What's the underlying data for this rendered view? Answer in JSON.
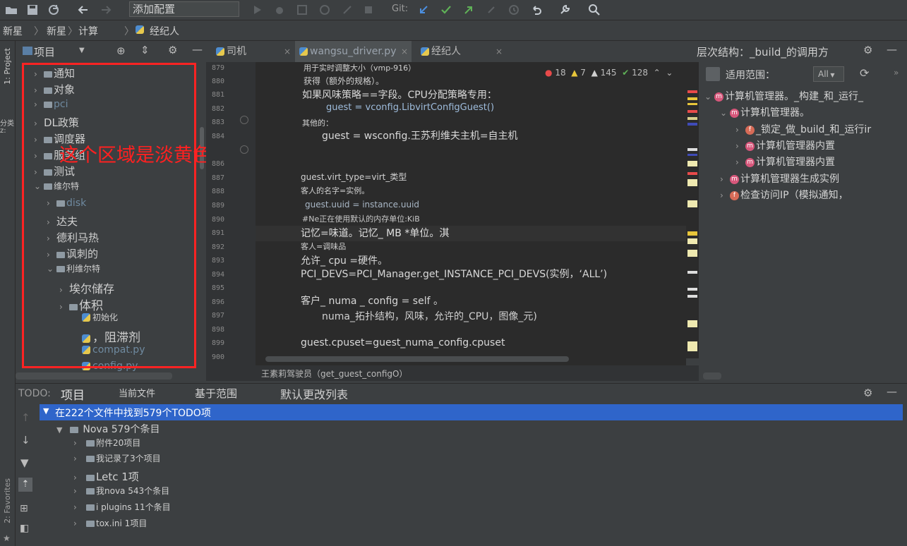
{
  "toolbar": {
    "config_combo": "添加配置",
    "git_label": "Git:"
  },
  "breadcrumb": [
    "新星",
    "新星",
    "计算",
    "经纪人"
  ],
  "left_stripe": {
    "project_tab": "1: Project",
    "structure_hint": "分类",
    "structure_hint2": "z:",
    "favorites_tab": "2: Favorites"
  },
  "project_panel": {
    "title": "项目",
    "items": [
      {
        "label": "通知",
        "indent": 1,
        "kind": "folder-arrow"
      },
      {
        "label": "对象",
        "indent": 1,
        "kind": "folder-arrow"
      },
      {
        "label": "pci",
        "indent": 1,
        "kind": "folder-arrow-dim"
      },
      {
        "label": "DL政策",
        "indent": 1,
        "kind": "arrow"
      },
      {
        "label": "调度器",
        "indent": 1,
        "kind": "folder-arrow"
      },
      {
        "label": "服务组",
        "indent": 1,
        "kind": "folder-arrow"
      },
      {
        "label": "测试",
        "indent": 1,
        "kind": "folder-arrow"
      },
      {
        "label": "维尔特",
        "indent": 1,
        "kind": "folder-open"
      },
      {
        "label": "disk",
        "indent": 2,
        "kind": "folder-arrow-dim"
      },
      {
        "label": "达夫",
        "indent": 2,
        "kind": "arrow"
      },
      {
        "label": "德利马热",
        "indent": 2,
        "kind": "arrow"
      },
      {
        "label": "讽刺的",
        "indent": 2,
        "kind": "folder-arrow"
      },
      {
        "label": "利维尔特",
        "indent": 2,
        "kind": "folder-open"
      },
      {
        "label": "埃尔储存",
        "indent": 3,
        "kind": "arrow"
      },
      {
        "label": "体积",
        "indent": 3,
        "kind": "folder-arrow"
      },
      {
        "label": "初始化",
        "indent": 4,
        "kind": "py"
      },
      {
        "label": "，阻滞剂",
        "indent": 4,
        "kind": "py"
      },
      {
        "label": "compat.py",
        "indent": 4,
        "kind": "py-dim"
      },
      {
        "label": "config.py",
        "indent": 4,
        "kind": "py-dim"
      }
    ],
    "annotation": "这个区域是淡黄色"
  },
  "editor": {
    "tabs": [
      "司机",
      "wangsu_driver.py",
      "经纪人"
    ],
    "inspections": {
      "errors": "18",
      "warnings": "7",
      "weak": "145",
      "ok": "128"
    },
    "line_numbers": [
      "879",
      "880",
      "881",
      "882",
      "883",
      "884",
      "886",
      "887",
      "888",
      "889",
      "890",
      "891",
      "892",
      "893",
      "894",
      "895",
      "896",
      "897",
      "898",
      "899",
      "900"
    ],
    "lines": [
      "用于实时调整大小（vmp-916）",
      "获得（额外的规格）。",
      "如果风味策略==字段。CPU分配策略专用：",
      "guest = vconfig.LibvirtConfigGuest()",
      "其他的：",
      "guest = wsconfig.王苏利维夫主机=自主机",
      "guest.virt_type=virt_类型",
      "客人的名字=实例。",
      "guest.uuid = instance.uuid",
      "#Ne正在使用默认的内存单位:KiB",
      "记忆=味道。记忆_ MB *单位。淇",
      "客人=调味品",
      "允许_ cpu =硬件。",
      "PCI_DEVS=PCI_Manager.get_INSTANCE_PCI_DEVS(实例，‘ALL’)",
      "客户_ numa _ config = self 。",
      "numa_拓扑结构，风味，允许的_CPU，图像_元)",
      "guest.cpuset=guest_numa_config.cpuset"
    ],
    "status_crumb": "王素莉驾驶员（get_guest_configO）"
  },
  "hierarchy": {
    "title": "层次结构：_build_的调用方",
    "scope_label": "适用范围：",
    "scope_value": "All",
    "items": [
      {
        "label": "计算机管理器。_构建_和_运行_",
        "indent": 0,
        "badge": "m"
      },
      {
        "label": "计算机管理器。",
        "indent": 1,
        "badge": "m"
      },
      {
        "label": "_锁定_做_build_和_运行ir",
        "indent": 2,
        "badge": "f"
      },
      {
        "label": "计算机管理器内置",
        "indent": 2,
        "badge": "m"
      },
      {
        "label": "计算机管理器内置",
        "indent": 2,
        "badge": "m"
      },
      {
        "label": "计算机管理器生成实例",
        "indent": 1,
        "badge": "m"
      },
      {
        "label": "检查访问IP（模拟通知，",
        "indent": 1,
        "badge": "f"
      }
    ]
  },
  "todo": {
    "panel_label": "TODO:",
    "tabs": [
      "项目",
      "当前文件",
      "基于范围",
      "默认更改列表"
    ],
    "summary": "在222个文件中找到579个TODO项",
    "root": "Nova 579个条目",
    "items": [
      "附件20项目",
      "我记录了3个项目",
      "Letc 1项",
      "我nova 543个条目",
      "i plugins 11个条目",
      "tox.ini 1项目"
    ]
  },
  "colors": {
    "accent_blue": "#2f65ca",
    "annotation_red": "#ff2323",
    "error_red": "#e84a4a",
    "warning_yellow": "#e8c63a",
    "ok_green": "#5fb157"
  }
}
